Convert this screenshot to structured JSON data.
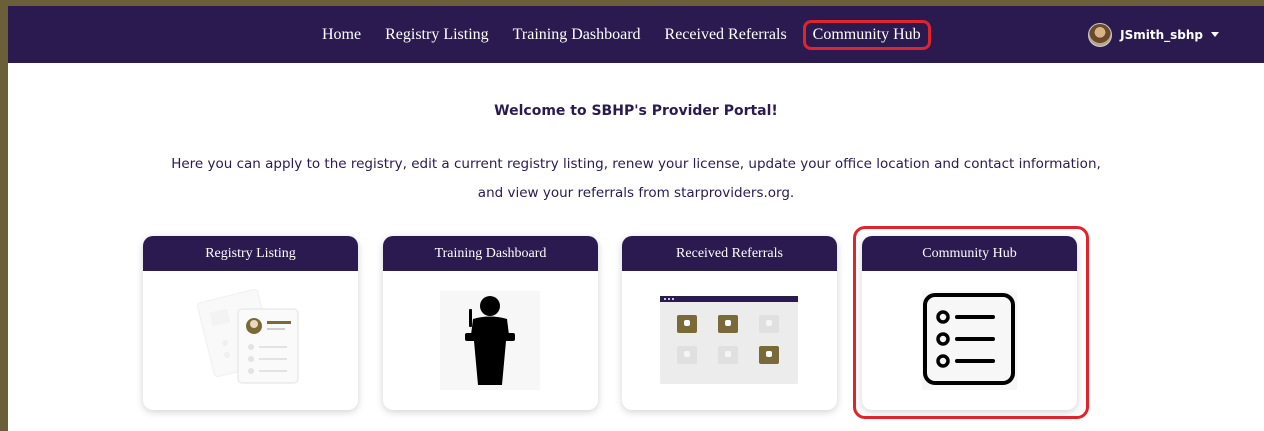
{
  "nav": {
    "links": [
      "Home",
      "Registry Listing",
      "Training Dashboard",
      "Received Referrals",
      "Community Hub"
    ],
    "username": "JSmith_sbhp"
  },
  "main": {
    "welcome": "Welcome to SBHP's Provider Portal!",
    "intro_line1": "Here you can apply to the registry, edit a current registry listing, renew your license, update your office location and contact information,",
    "intro_line2": "and view your referrals from starproviders.org."
  },
  "cards": [
    {
      "title": "Registry Listing",
      "icon": "document-profile-icon"
    },
    {
      "title": "Training Dashboard",
      "icon": "presenter-podium-icon"
    },
    {
      "title": "Received Referrals",
      "icon": "video-grid-icon"
    },
    {
      "title": "Community Hub",
      "icon": "checklist-icon"
    }
  ],
  "colors": {
    "navbar": "#2b1a4f",
    "accent_gold": "#7a6a3a",
    "highlight_red": "#e0242b",
    "outer_frame": "#6b5f3a"
  }
}
